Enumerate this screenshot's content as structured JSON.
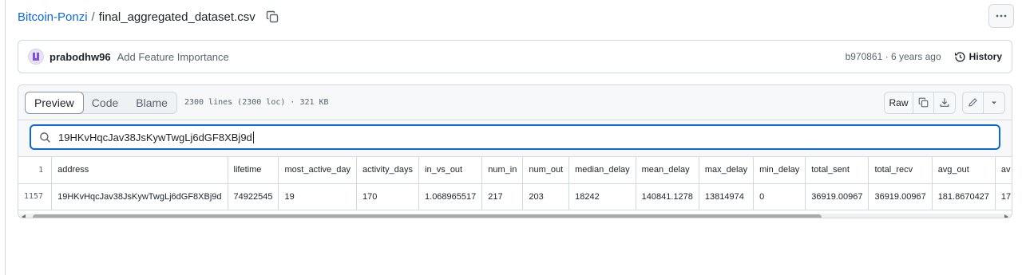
{
  "breadcrumb": {
    "repo": "Bitcoin-Ponzi",
    "separator": "/",
    "file": "final_aggregated_dataset.csv"
  },
  "commit": {
    "author": "prabodhw96",
    "message": "Add Feature Importance",
    "hash_time": "b970861 · 6 years ago",
    "history_label": "History"
  },
  "file_header": {
    "tabs": [
      "Preview",
      "Code",
      "Blame"
    ],
    "active_tab": "Preview",
    "info": "2300 lines (2300 loc) · 321 KB",
    "raw_label": "Raw"
  },
  "search": {
    "value": "19HKvHqcJav38JsKywTwgLj6dGF8XBj9d"
  },
  "table": {
    "header_line": "1",
    "columns": [
      "address",
      "lifetime",
      "most_active_day",
      "activity_days",
      "in_vs_out",
      "num_in",
      "num_out",
      "median_delay",
      "mean_delay",
      "max_delay",
      "min_delay",
      "total_sent",
      "total_recv",
      "avg_out",
      "av"
    ],
    "rows": [
      {
        "line": "1157",
        "cells": [
          "19HKvHqcJav38JsKywTwgLj6dGF8XBj9d",
          "74922545",
          "19",
          "170",
          "1.068965517",
          "217",
          "203",
          "18242",
          "140841.1278",
          "13814974",
          "0",
          "36919.00967",
          "36919.00967",
          "181.8670427",
          "17"
        ]
      }
    ]
  },
  "colors": {
    "link": "#0969da",
    "border": "#d1d9e0",
    "focus": "#0969da",
    "muted": "#59636e"
  },
  "icons": [
    "copy-icon",
    "kebab-icon",
    "avatar",
    "history-icon",
    "search-icon",
    "copy-icon",
    "download-icon",
    "pencil-icon",
    "triangle-down-icon"
  ]
}
